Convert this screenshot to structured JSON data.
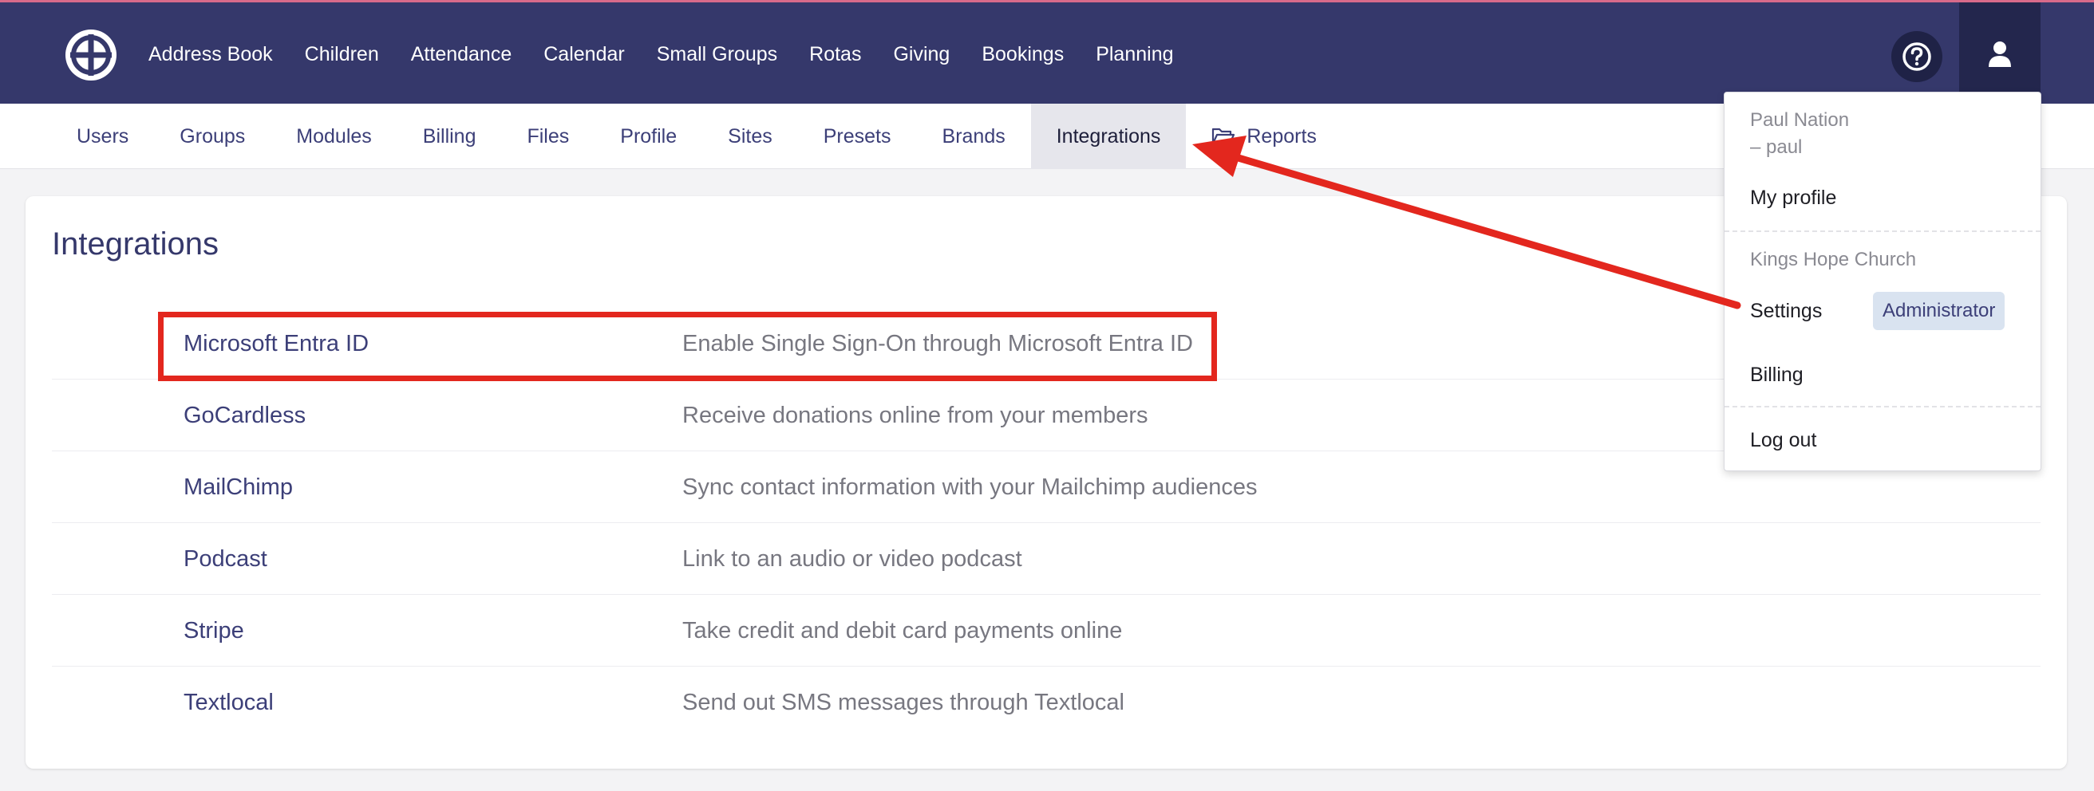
{
  "topnav": {
    "items": [
      "Address Book",
      "Children",
      "Attendance",
      "Calendar",
      "Small Groups",
      "Rotas",
      "Giving",
      "Bookings",
      "Planning"
    ],
    "help_icon": "question-circle-icon",
    "user_icon": "user-icon"
  },
  "subnav": {
    "items": [
      "Users",
      "Groups",
      "Modules",
      "Billing",
      "Files",
      "Profile",
      "Sites",
      "Presets",
      "Brands",
      "Integrations"
    ],
    "reports_label": "Reports",
    "active": "Integrations"
  },
  "page": {
    "title": "Integrations",
    "rows": [
      {
        "name": "Microsoft Entra ID",
        "description": "Enable Single Sign-On through Microsoft Entra ID"
      },
      {
        "name": "GoCardless",
        "description": "Receive donations online from your members"
      },
      {
        "name": "MailChimp",
        "description": "Sync contact information with your Mailchimp audiences"
      },
      {
        "name": "Podcast",
        "description": "Link to an audio or video podcast"
      },
      {
        "name": "Stripe",
        "description": "Take credit and debit card payments online"
      },
      {
        "name": "Textlocal",
        "description": "Send out SMS messages through Textlocal"
      }
    ]
  },
  "dropdown": {
    "user_name": "Paul Nation",
    "username": "– paul",
    "my_profile": "My profile",
    "church": "Kings Hope Church",
    "settings": "Settings",
    "role_badge": "Administrator",
    "billing": "Billing",
    "logout": "Log out"
  },
  "colors": {
    "nav_bg": "#35386b",
    "accent_text": "#3c3f78",
    "annotation_red": "#e3271e"
  }
}
